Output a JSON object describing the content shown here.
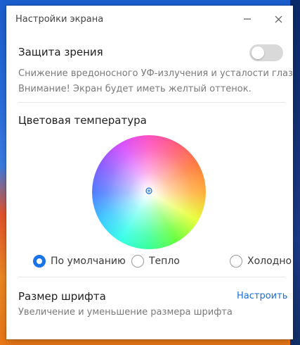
{
  "window": {
    "title": "Настройки экрана",
    "minimize_icon": "minimize-icon",
    "close_icon": "close-icon"
  },
  "eye_protection": {
    "label": "Защита зрения",
    "enabled": false,
    "description_line1": "Снижение вредоносного УФ-излучения и усталости глаз",
    "description_line2": "Внимание! Экран будет иметь желтый оттенок."
  },
  "color_temperature": {
    "label": "Цветовая температура",
    "options": [
      {
        "label": "По умолчанию",
        "selected": true
      },
      {
        "label": "Тепло",
        "selected": false
      },
      {
        "label": "Холодно",
        "selected": false
      }
    ]
  },
  "font_size": {
    "label": "Размер шрифта",
    "link": "Настроить",
    "description": "Увеличение и уменьшение размера шрифта"
  },
  "colors": {
    "accent": "#1a73e8",
    "toggle_off": "#d9d9d9"
  }
}
